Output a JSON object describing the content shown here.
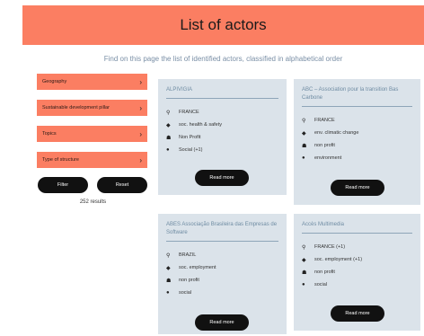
{
  "header": {
    "title": "List of actors"
  },
  "subtitle": "Find on this page the list of identified actors, classified in alphabetical order",
  "filters": [
    {
      "label": "Geography"
    },
    {
      "label": "Sustainable development pillar"
    },
    {
      "label": "Topics"
    },
    {
      "label": "Type of structure"
    }
  ],
  "buttons": {
    "filter": "Filter",
    "reset": "Reset"
  },
  "results": "252 results",
  "cards": [
    {
      "title": "ALPIVIGIA",
      "country": "FRANCE",
      "topic": "soc. health & safety",
      "structure": "Non Profit",
      "pillar": "Social (+1)",
      "more": "Read more"
    },
    {
      "title": "ABC – Association pour la transition Bas Carbone",
      "country": "FRANCE",
      "topic": "env. climatic change",
      "structure": "non profit",
      "pillar": "environment",
      "more": "Read more"
    },
    {
      "title": "ABES Associação Brasileira das Empresas de Software",
      "country": "BRAZIL",
      "topic": "soc. employment",
      "structure": "non profit",
      "pillar": "social",
      "more": "Read more"
    },
    {
      "title": "Accès Multimedia",
      "country": "FRANCE (+1)",
      "topic": "soc. employment (+1)",
      "structure": "non profit",
      "pillar": "social",
      "more": "Read more"
    }
  ]
}
